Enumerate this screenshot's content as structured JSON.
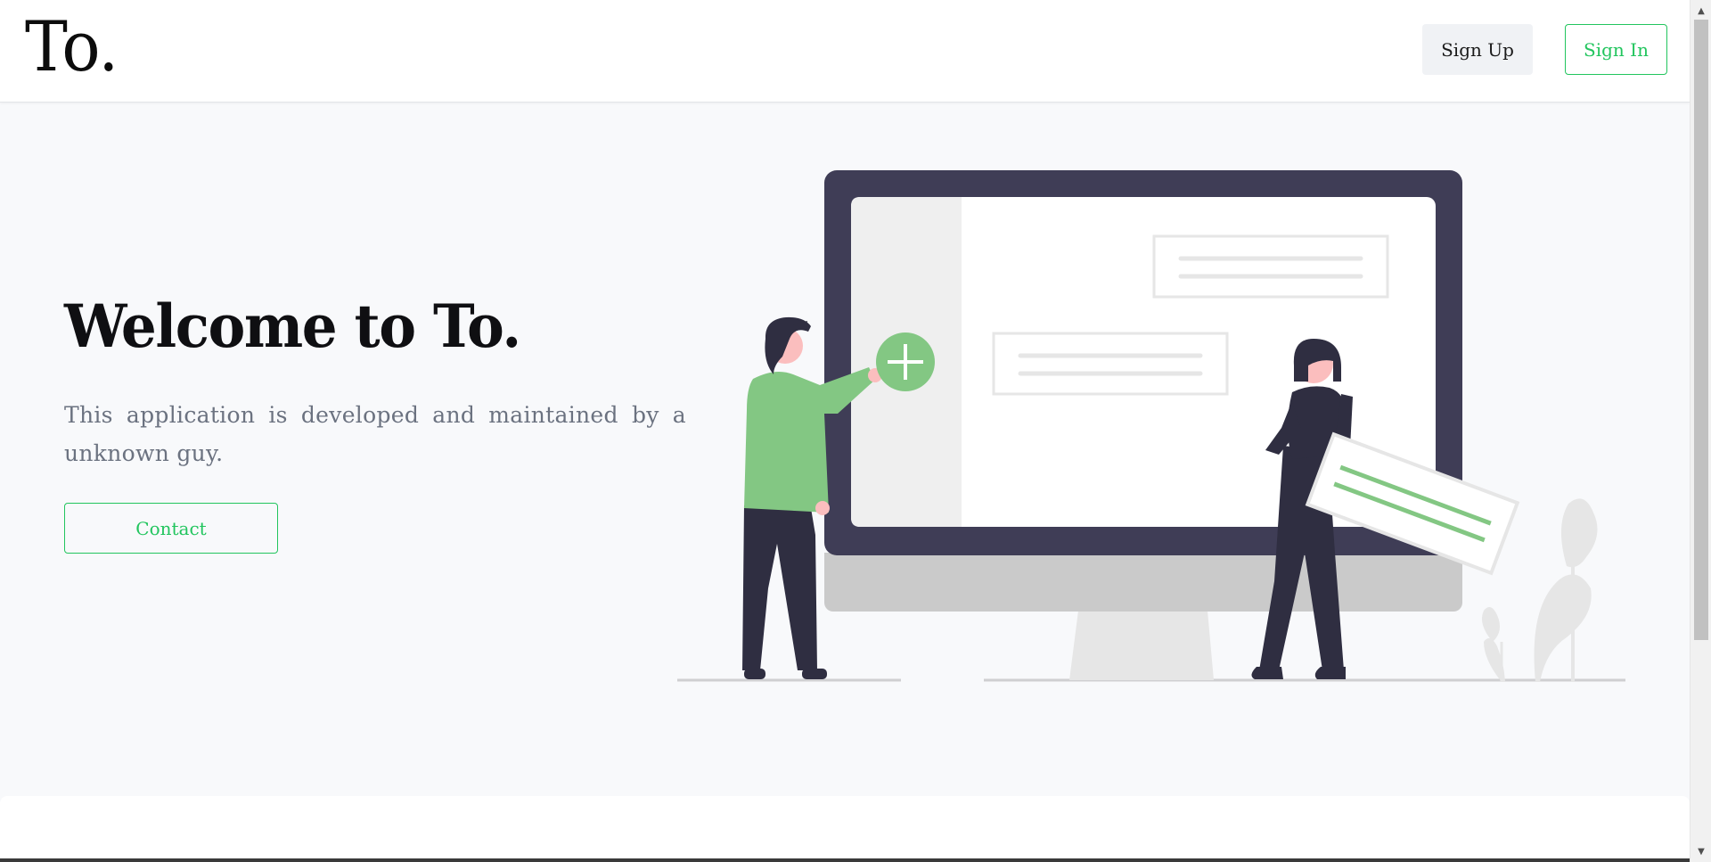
{
  "header": {
    "logo": "To.",
    "signup_label": "Sign Up",
    "signin_label": "Sign In"
  },
  "hero": {
    "title": "Welcome to To.",
    "description": "This application is developed and maintained by a unknown guy.",
    "contact_label": "Contact",
    "illustration": "people-adding-content-to-screen-illustration"
  },
  "colors": {
    "accent": "#22c55e",
    "illustration_green": "#83c783",
    "monitor_frame": "#3f3d56",
    "background": "#f8f9fb"
  },
  "scrollbar": {
    "up_icon": "scroll-up-arrow",
    "down_icon": "scroll-down-arrow"
  }
}
